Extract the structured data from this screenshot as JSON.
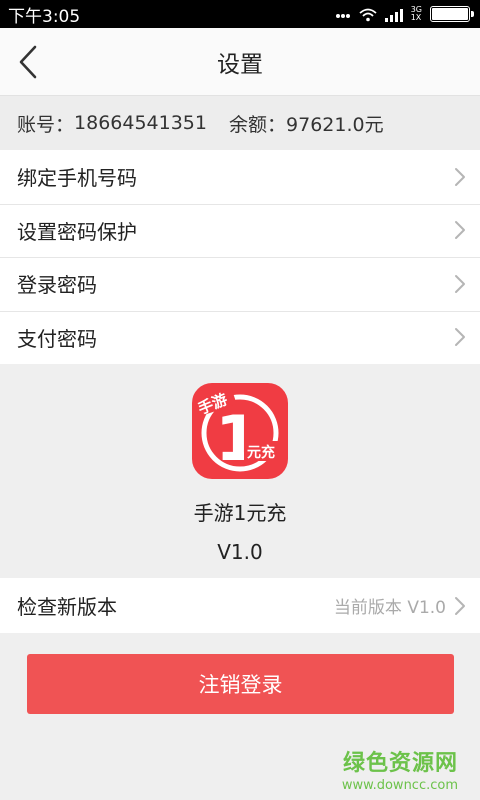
{
  "status_bar": {
    "time": "下午3:05",
    "network_top": "3G",
    "network_bottom": "1X"
  },
  "app_bar": {
    "title": "设置",
    "back_icon": "chevron-left-icon"
  },
  "account": {
    "account_label": "账号：",
    "account_value": "18664541351",
    "balance_label": "余额：",
    "balance_value": "97621.0元"
  },
  "menu": {
    "items": [
      {
        "label": "绑定手机号码"
      },
      {
        "label": "设置密码保护"
      },
      {
        "label": "登录密码"
      },
      {
        "label": "支付密码"
      }
    ]
  },
  "about": {
    "logo_top_text": "手游",
    "logo_number": "1",
    "logo_badge_text": "元充",
    "app_name": "手游1元充",
    "version": "V1.0"
  },
  "update": {
    "label": "检查新版本",
    "status": "当前版本 V1.0"
  },
  "logout": {
    "label": "注销登录"
  },
  "watermark": {
    "title": "绿色资源网",
    "url": "www.downcc.com"
  },
  "colors": {
    "accent": "#f05354",
    "logo_red": "#f03c43",
    "watermark_green": "#6cc24a"
  }
}
